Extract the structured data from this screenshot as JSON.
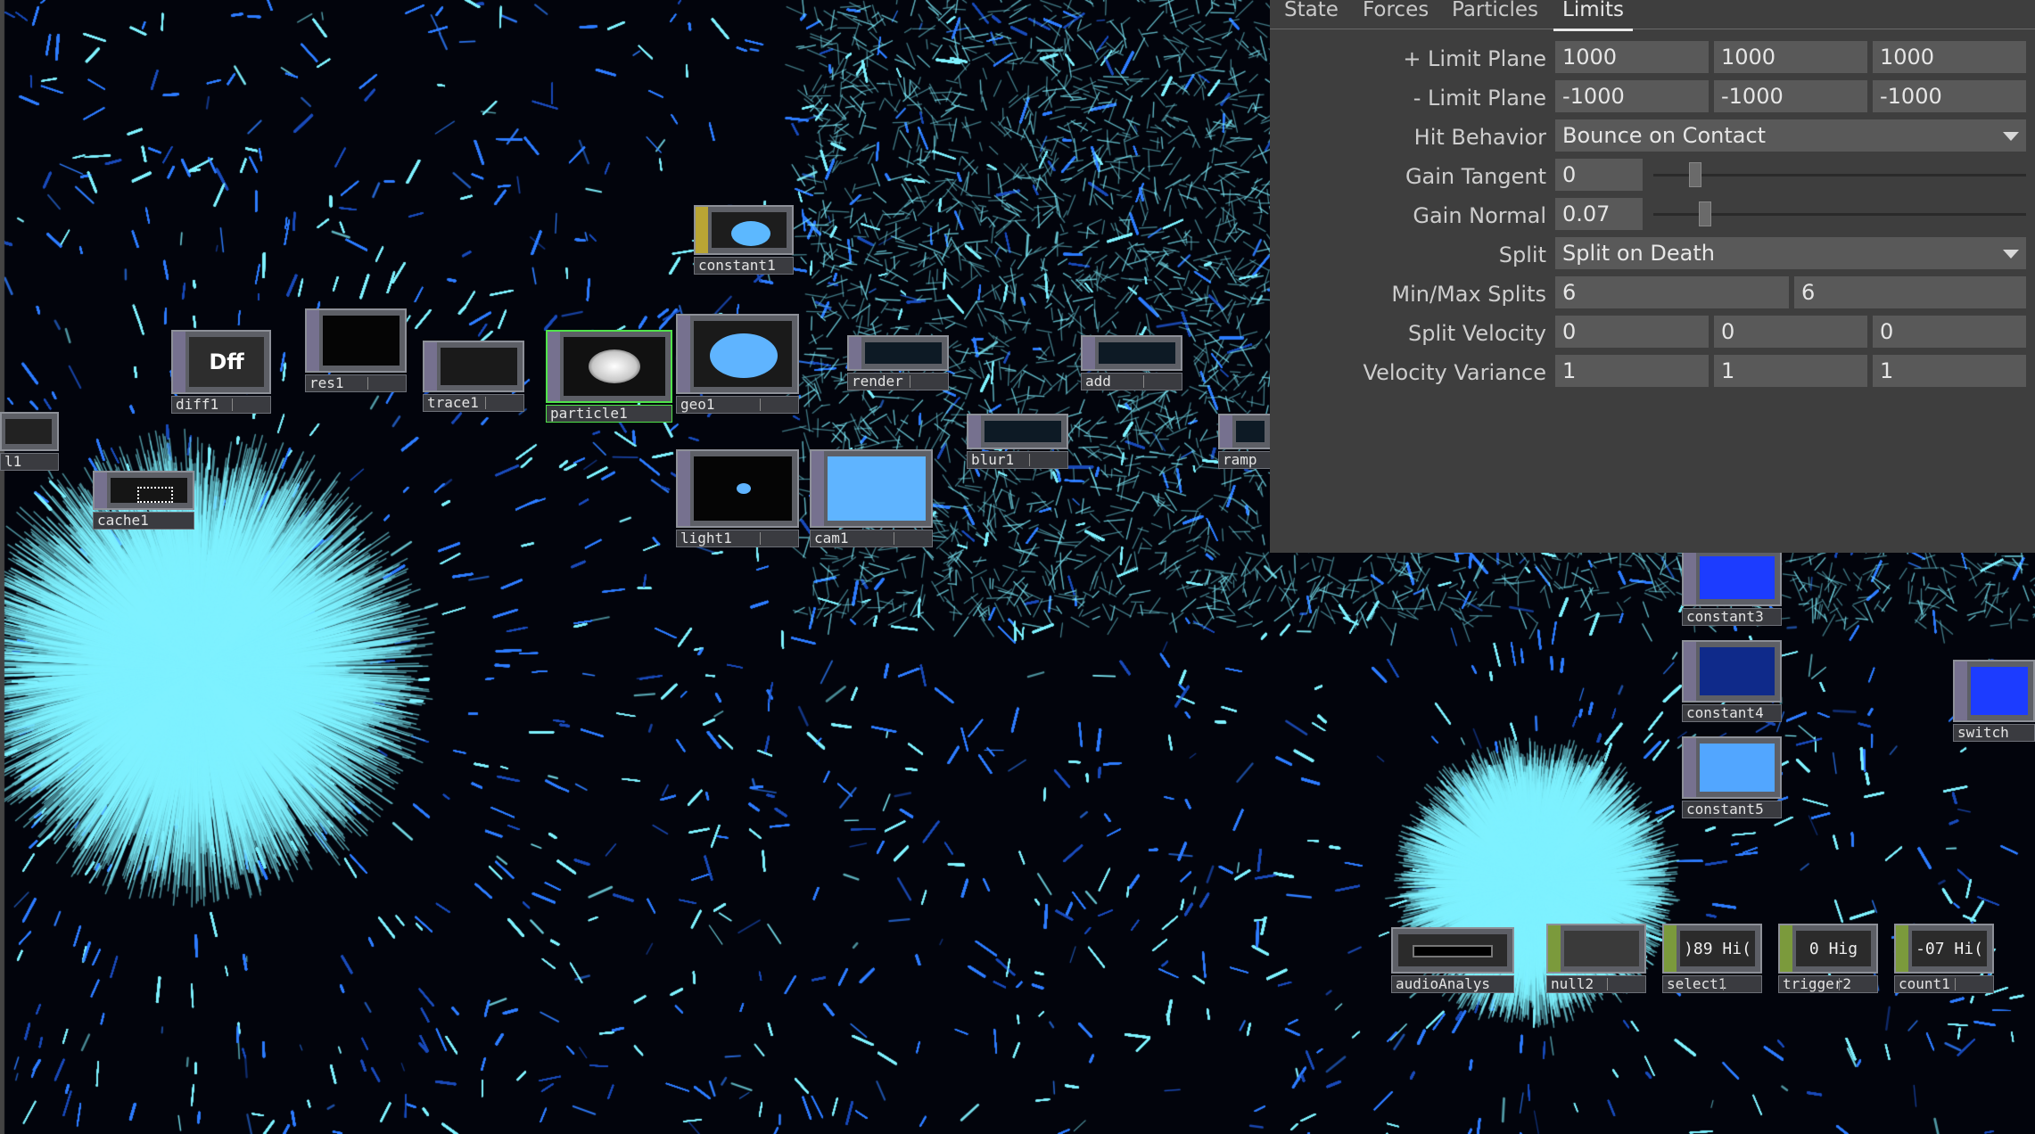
{
  "colors": {
    "panel_bg": "#3e3e3e",
    "field_bg": "#595959",
    "particle_cyan": "#7ff2ff",
    "particle_blue": "#2f7dff",
    "selected_green": "#4fe34a"
  },
  "panel": {
    "tabs": [
      "State",
      "Forces",
      "Particles",
      "Limits"
    ],
    "active_tab": "Limits",
    "params": {
      "limit_plus": {
        "label": "+ Limit Plane",
        "values": [
          "1000",
          "1000",
          "1000"
        ]
      },
      "limit_minus": {
        "label": "- Limit Plane",
        "values": [
          "-1000",
          "-1000",
          "-1000"
        ]
      },
      "hit_behavior": {
        "label": "Hit Behavior",
        "value": "Bounce on Contact"
      },
      "gain_tangent": {
        "label": "Gain Tangent",
        "value": "0",
        "slider_fraction": 0.0
      },
      "gain_normal": {
        "label": "Gain Normal",
        "value": "0.07",
        "slider_fraction": 0.07
      },
      "split": {
        "label": "Split",
        "value": "Split on Death"
      },
      "min_max_splits": {
        "label": "Min/Max Splits",
        "values": [
          "6",
          "6"
        ]
      },
      "split_velocity": {
        "label": "Split Velocity",
        "values": [
          "0",
          "0",
          "0"
        ]
      },
      "velocity_variance": {
        "label": "Velocity Variance",
        "values": [
          "1",
          "1",
          "1"
        ]
      }
    }
  },
  "nodes": {
    "diff1": {
      "label": "diff1",
      "thumb_text": "Dff"
    },
    "res1": {
      "label": "res1"
    },
    "trace1": {
      "label": "trace1"
    },
    "particle1": {
      "label": "particle1"
    },
    "constant1": {
      "label": "constant1"
    },
    "geo1": {
      "label": "geo1"
    },
    "render": {
      "label": "render"
    },
    "add": {
      "label": "add"
    },
    "blur1": {
      "label": "blur1"
    },
    "ramp": {
      "label": "ramp"
    },
    "light1": {
      "label": "light1"
    },
    "cam1": {
      "label": "cam1"
    },
    "cache1": {
      "label": "cache1"
    },
    "left_partial": {
      "label": "l1"
    },
    "constant3": {
      "label": "constant3"
    },
    "constant4": {
      "label": "constant4"
    },
    "constant5": {
      "label": "constant5"
    },
    "switch": {
      "label": "switch"
    },
    "audioanalysis": {
      "label": "audioAnalys"
    },
    "null2": {
      "label": "null2"
    },
    "select1": {
      "label": "select1",
      "thumb_text": ")89 Hi("
    },
    "trigger2": {
      "label": "trigger2",
      "thumb_text": "0 Hig"
    },
    "count1": {
      "label": "count1",
      "thumb_text": "-07 Hi("
    }
  }
}
